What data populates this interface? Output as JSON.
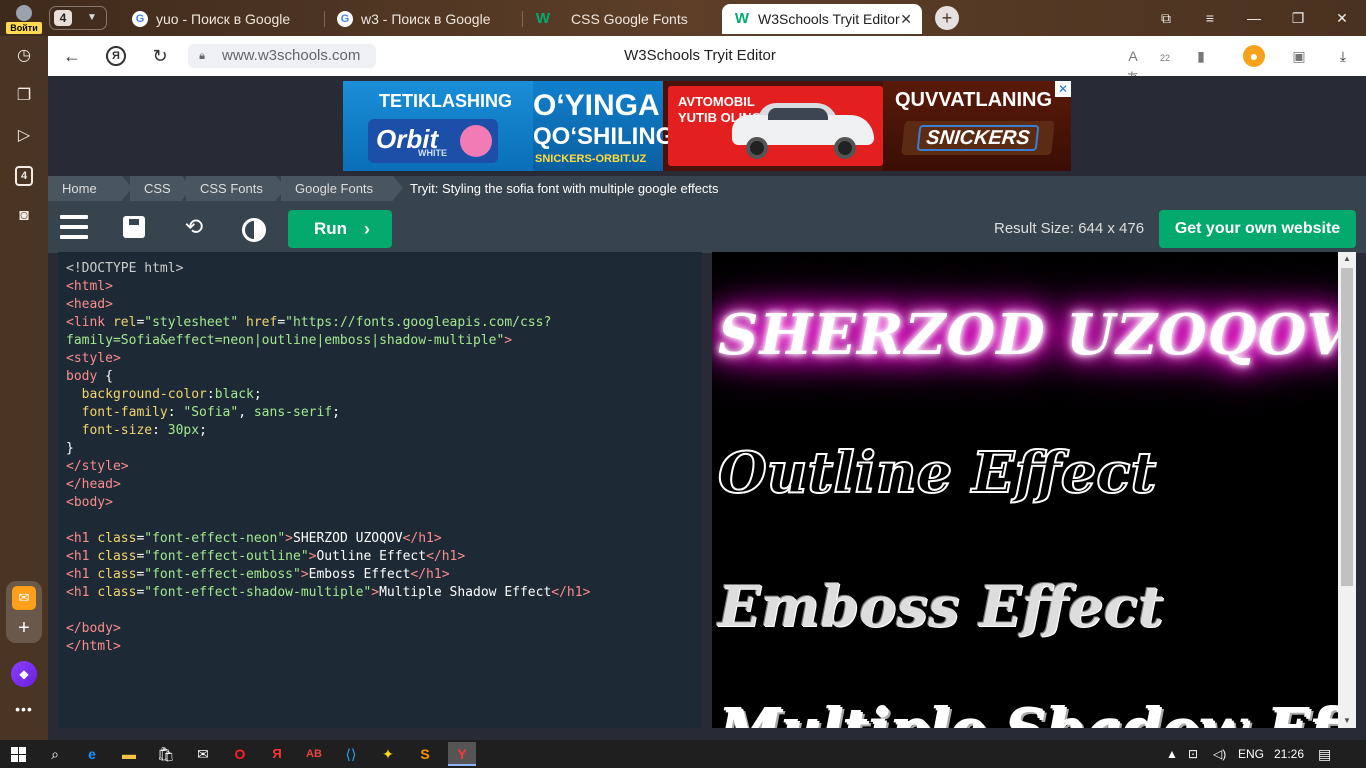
{
  "browser": {
    "profile_label": "Войти",
    "tab_count": "4",
    "tabs": [
      {
        "title": "yuo - Поиск в Google",
        "favicon": "G"
      },
      {
        "title": "w3 - Поиск в Google",
        "favicon": "G"
      },
      {
        "title": "CSS Google Fonts",
        "favicon": "W"
      },
      {
        "title": "W3Schools Tryit Editor",
        "favicon": "W"
      }
    ],
    "url": "www.w3schools.com",
    "page_title": "W3Schools Tryit Editor",
    "sidebar_badge": "4",
    "notification_count": "22"
  },
  "ad": {
    "left_heading": "TETIKLASHING",
    "orbit_brand": "Orbit",
    "orbit_sub": "WHITE",
    "center_heading_1": "O‘YINGA",
    "center_heading_2": "QO‘SHILING",
    "center_site": "SNICKERS-ORBIT.UZ",
    "car_heading_1": "AVTOMOBIL",
    "car_heading_2": "YUTIB OLING",
    "right_heading": "QUVVATLANING",
    "snickers_brand": "SNICKERS",
    "close": "✕"
  },
  "breadcrumb": {
    "items": [
      "Home",
      "CSS",
      "CSS Fonts",
      "Google Fonts"
    ],
    "current": "Tryit: Styling the sofia font with multiple google effects"
  },
  "toolbar": {
    "run_label": "Run",
    "result_size": "Result Size: 644 x 476",
    "get_website_label": "Get your own website"
  },
  "code": {
    "doctype": "<!DOCTYPE html>",
    "link_href_1": "\"https://fonts.googleapis.com/css?",
    "link_href_2": "family=Sofia&effect=neon|outline|emboss|shadow-multiple\"",
    "bg_value": "black",
    "font_value_1": "\"Sofia\"",
    "font_value_2": "sans-serif",
    "size_value": "30px",
    "h1_neon_class": "\"font-effect-neon\"",
    "h1_neon_text": "SHERZOD UZOQOV",
    "h1_outline_class": "\"font-effect-outline\"",
    "h1_outline_text": "Outline Effect",
    "h1_emboss_class": "\"font-effect-emboss\"",
    "h1_emboss_text": "Emboss Effect",
    "h1_shadow_class": "\"font-effect-shadow-multiple\"",
    "h1_shadow_text": "Multiple Shadow Effect"
  },
  "result": {
    "neon": "SHERZOD UZOQOV",
    "outline": "Outline Effect",
    "emboss": "Emboss Effect",
    "shadow": "Multiple Shadow Effect"
  },
  "taskbar": {
    "language": "ENG",
    "time": "21:26"
  },
  "colors": {
    "w3_green": "#04aa6d",
    "neon_glow": "#ff00de",
    "code_bg": "#1d2a35",
    "toolbar_bg": "#38444d"
  }
}
